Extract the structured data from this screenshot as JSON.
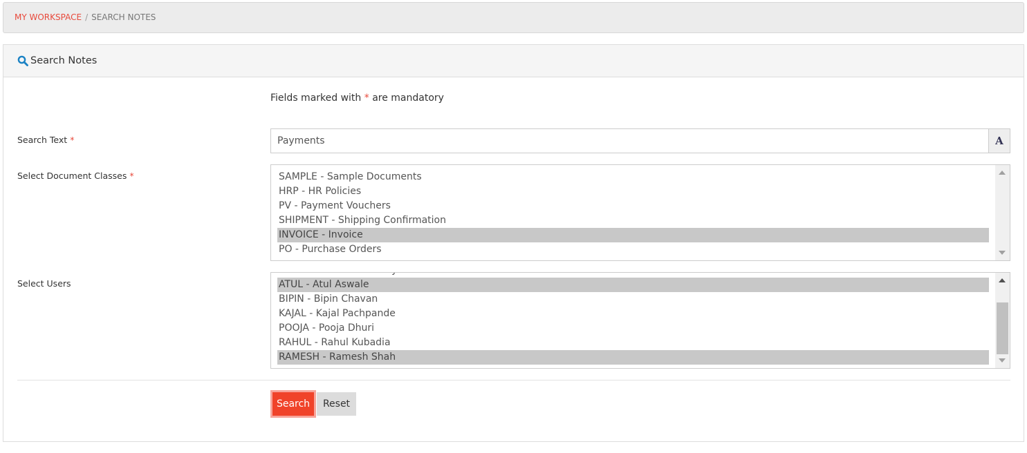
{
  "breadcrumb": {
    "items": [
      {
        "label": "MY WORKSPACE",
        "link": true
      },
      {
        "label": "SEARCH NOTES",
        "link": false
      }
    ],
    "separator": "/"
  },
  "panel": {
    "title": "Search Notes",
    "icon": "search-icon"
  },
  "form": {
    "mandatory_note_prefix": "Fields marked with ",
    "mandatory_note_star": "*",
    "mandatory_note_suffix": " are mandatory",
    "search_text": {
      "label": "Search Text",
      "required_marker": "*",
      "value": "Payments",
      "addon_icon": "font-icon",
      "addon_glyph": "A"
    },
    "document_classes": {
      "label": "Select Document Classes",
      "required_marker": "*",
      "options": [
        {
          "label": "SAMPLE - Sample Documents",
          "selected": false
        },
        {
          "label": "HRP - HR Policies",
          "selected": false
        },
        {
          "label": "PV - Payment Vouchers",
          "selected": false
        },
        {
          "label": "SHIPMENT - Shipping Confirmation",
          "selected": false
        },
        {
          "label": "INVOICE - Invoice",
          "selected": true
        },
        {
          "label": "PO - Purchase Orders",
          "selected": false
        }
      ]
    },
    "users": {
      "label": "Select Users",
      "options": [
        {
          "label": "ASHWIN - Ashwin Shetty",
          "selected": false
        },
        {
          "label": "ATUL - Atul Aswale",
          "selected": true
        },
        {
          "label": "BIPIN - Bipin Chavan",
          "selected": false
        },
        {
          "label": "KAJAL - Kajal Pachpande",
          "selected": false
        },
        {
          "label": "POOJA - Pooja Dhuri",
          "selected": false
        },
        {
          "label": "RAHUL - Rahul Kubadia",
          "selected": false
        },
        {
          "label": "RAMESH - Ramesh Shah",
          "selected": true
        }
      ]
    },
    "buttons": {
      "search_label": "Search",
      "reset_label": "Reset"
    }
  },
  "colors": {
    "accent": "#f0432a",
    "link": "#e8493b",
    "icon_blue": "#1a82c4",
    "selected_option": "#c8c8c8"
  }
}
